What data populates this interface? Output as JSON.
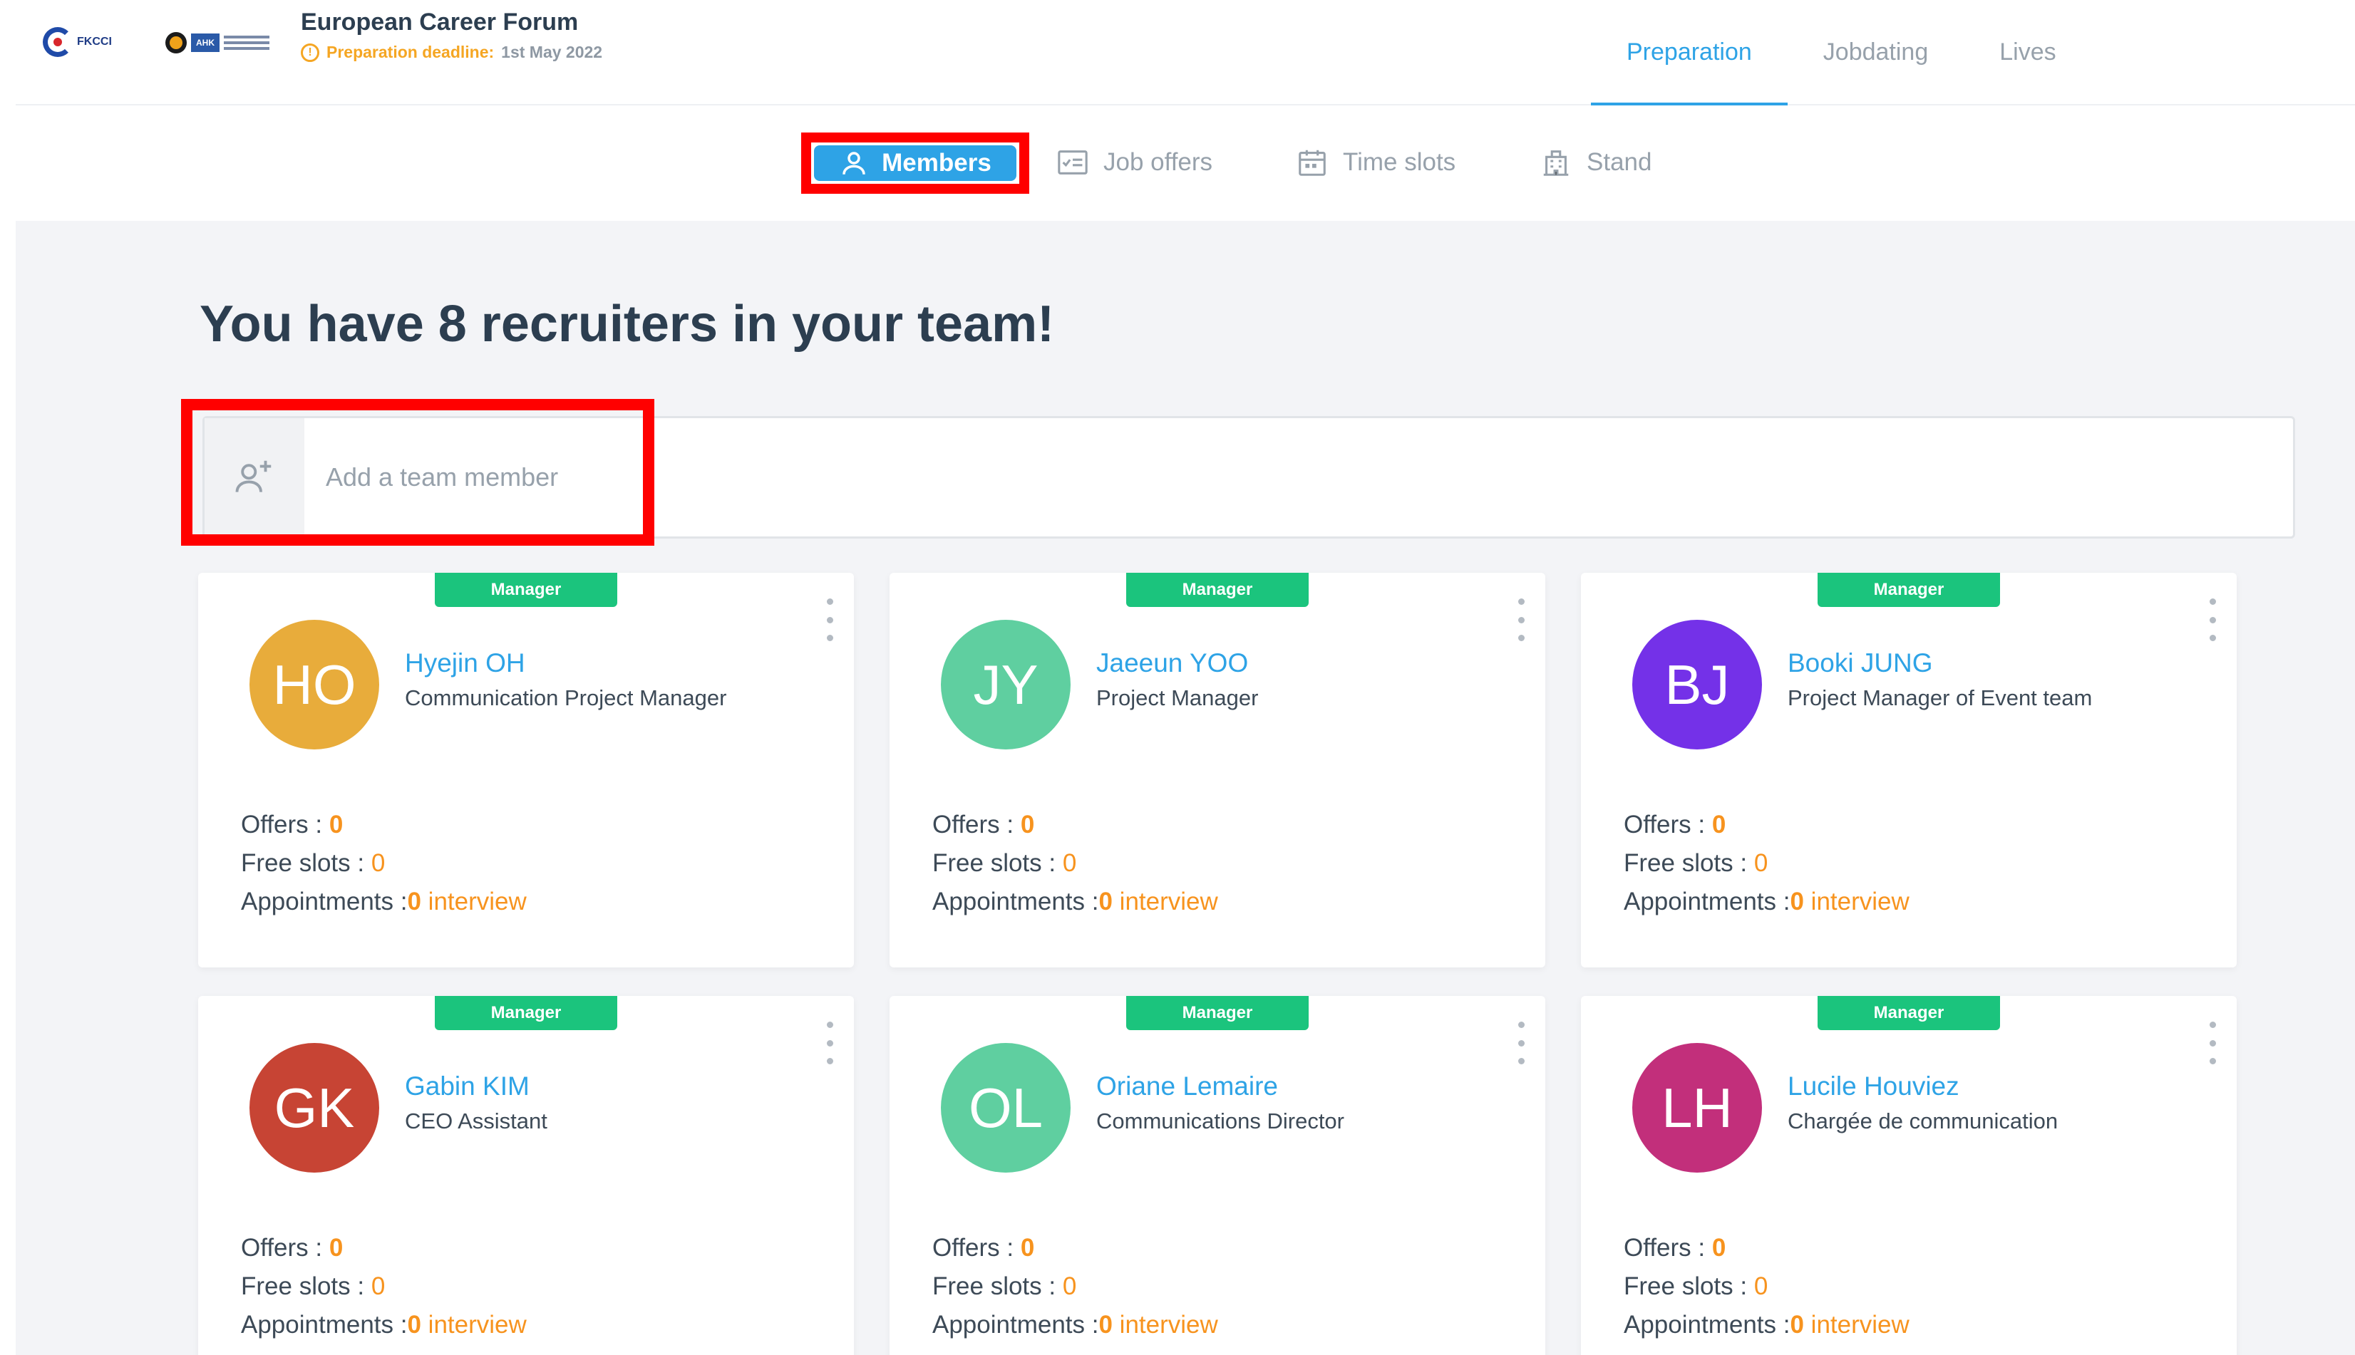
{
  "header": {
    "logo_fkcci": "FKCCI",
    "logo_ahk": "AHK",
    "event_title": "European Career Forum",
    "deadline_label": "Preparation deadline:",
    "deadline_date": "1st May 2022",
    "tabs": [
      {
        "label": "Preparation",
        "active": true
      },
      {
        "label": "Jobdating",
        "active": false
      },
      {
        "label": "Lives",
        "active": false
      }
    ]
  },
  "subnav": {
    "members": "Members",
    "job_offers": "Job offers",
    "time_slots": "Time slots",
    "stand": "Stand"
  },
  "main": {
    "headline": "You have 8 recruiters in your team!",
    "add_member_placeholder": "Add a team member"
  },
  "labels": {
    "offers": "Offers : ",
    "free_slots": "Free slots : ",
    "appointments": "Appointments :",
    "interview": " interview"
  },
  "members": [
    {
      "initials": "HO",
      "name": "Hyejin OH",
      "role": "Communication Project Manager",
      "badge": "Manager",
      "color": "#e8ac3b",
      "offers": "0",
      "free_slots": "0",
      "appointments": "0"
    },
    {
      "initials": "JY",
      "name": "Jaeeun YOO",
      "role": "Project Manager",
      "badge": "Manager",
      "color": "#5fcfa0",
      "offers": "0",
      "free_slots": "0",
      "appointments": "0"
    },
    {
      "initials": "BJ",
      "name": "Booki JUNG",
      "role": "Project Manager of Event team",
      "badge": "Manager",
      "color": "#7431e8",
      "offers": "0",
      "free_slots": "0",
      "appointments": "0"
    },
    {
      "initials": "GK",
      "name": "Gabin KIM",
      "role": "CEO Assistant",
      "badge": "Manager",
      "color": "#c74434",
      "offers": "0",
      "free_slots": "0",
      "appointments": "0"
    },
    {
      "initials": "OL",
      "name": "Oriane Lemaire",
      "role": "Communications Director",
      "badge": "Manager",
      "color": "#5fcfa0",
      "offers": "0",
      "free_slots": "0",
      "appointments": "0"
    },
    {
      "initials": "LH",
      "name": "Lucile Houviez",
      "role": "Chargée de communication",
      "badge": "Manager",
      "color": "#c22f7b",
      "offers": "0",
      "free_slots": "0",
      "appointments": "0"
    }
  ],
  "colors": {
    "accent": "#2ea3e6",
    "badge": "#1bc47d",
    "stat_value": "#f7931e",
    "highlight": "#ff0000"
  }
}
